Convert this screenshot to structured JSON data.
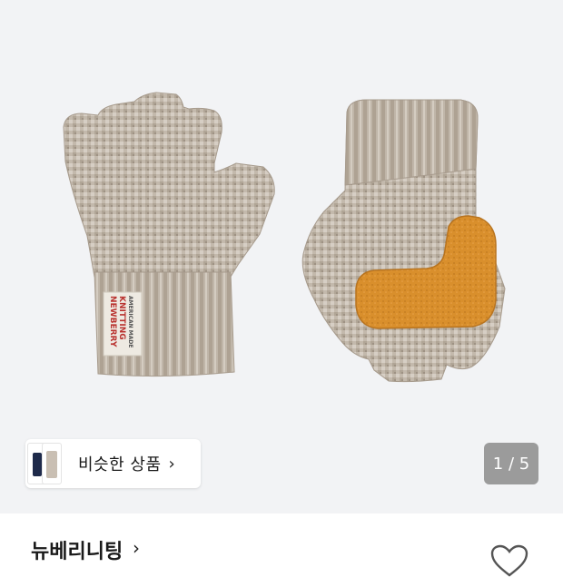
{
  "product": {
    "image_alt": "Newberry Knitting fingerless gloves",
    "gauge_counter": "1 / 5"
  },
  "similar": {
    "label": "비슷한 상품",
    "chevron": "›",
    "thumb_icons": [
      "navy-glove-thumbnail",
      "oatmeal-glove-thumbnail"
    ]
  },
  "brand": {
    "name": "뉴베리니팅",
    "chevron": "›"
  },
  "label_tag": {
    "line1": "NEWBERRY",
    "line2": "KNITTING",
    "line3": "AMERICAN MADE"
  },
  "icons": {
    "wishlist": "heart-outline-icon"
  },
  "colors": {
    "hero_bg": "#f2f3f5",
    "glove_knit": "#bdb3a6",
    "leather_patch": "#d9902e",
    "counter_bg": "#9b9b9b"
  }
}
